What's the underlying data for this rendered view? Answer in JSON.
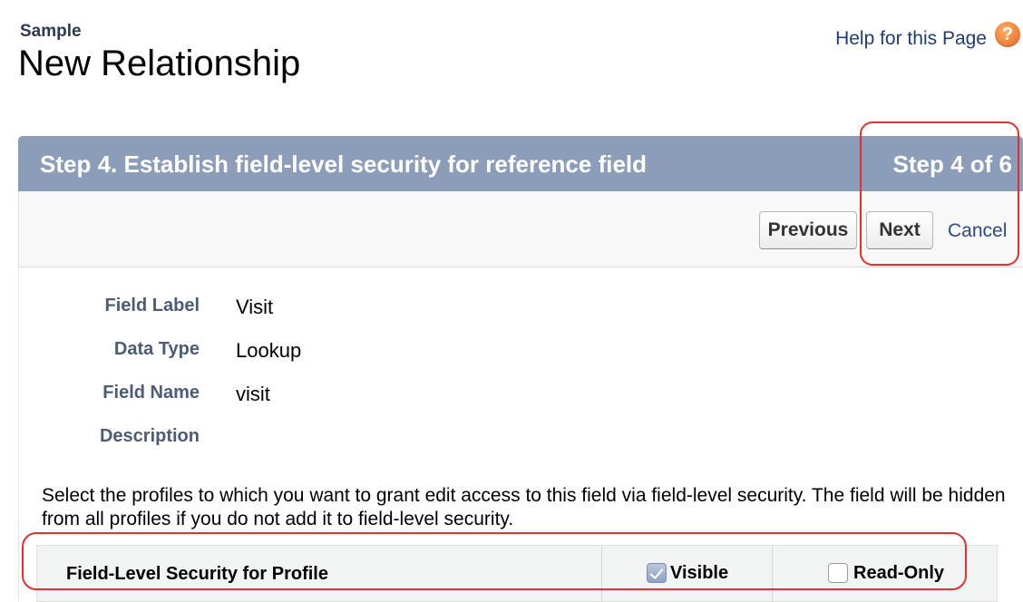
{
  "header": {
    "breadcrumb": "Sample",
    "title": "New Relationship",
    "help_label": "Help for this Page",
    "help_icon": "question-mark-icon"
  },
  "step": {
    "title": "Step 4. Establish field-level security for reference field",
    "counter": "Step 4 of 6"
  },
  "buttons": {
    "previous": "Previous",
    "next": "Next",
    "cancel": "Cancel"
  },
  "fields": [
    {
      "label": "Field Label",
      "value": "Visit"
    },
    {
      "label": "Data Type",
      "value": "Lookup"
    },
    {
      "label": "Field Name",
      "value": "visit"
    },
    {
      "label": "Description",
      "value": ""
    }
  ],
  "instructions": "Select the profiles to which you want to grant edit access to this field via field-level security. The field will be hidden from all profiles if you do not add it to field-level security.",
  "table": {
    "header_profile": "Field-Level Security for Profile",
    "header_visible": "Visible",
    "header_readonly": "Read-Only",
    "visible_checked": true,
    "readonly_checked": false
  },
  "colors": {
    "step_header": "#8c9dba",
    "annotation": "#e0322b",
    "link": "#2a4a8a"
  }
}
